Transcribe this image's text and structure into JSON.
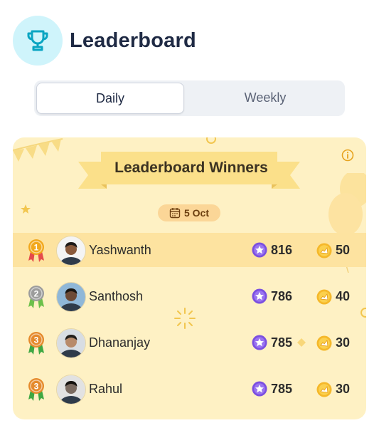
{
  "header": {
    "title": "Leaderboard",
    "icon": "trophy-icon"
  },
  "tabs": [
    {
      "label": "Daily",
      "active": true
    },
    {
      "label": "Weekly",
      "active": false
    }
  ],
  "winners": {
    "title": "Leaderboard Winners",
    "date": "5 Oct",
    "rows": [
      {
        "rank": "1",
        "name": "Yashwanth",
        "gems": "816",
        "coins": "50",
        "medal_color": "#f2a81d",
        "ribbon": "#e54b4b"
      },
      {
        "rank": "2",
        "name": "Santhosh",
        "gems": "786",
        "coins": "40",
        "medal_color": "#9c9c9c",
        "ribbon": "#6cc04a"
      },
      {
        "rank": "3",
        "name": "Dhananjay",
        "gems": "785",
        "coins": "30",
        "medal_color": "#e58a2c",
        "ribbon": "#3fa843"
      },
      {
        "rank": "3",
        "name": "Rahul",
        "gems": "785",
        "coins": "30",
        "medal_color": "#e58a2c",
        "ribbon": "#3fa843"
      }
    ]
  },
  "colors": {
    "card_bg": "#fef1c4",
    "highlight_row": "#fde3a0",
    "gem": "#7b4fe0",
    "coin": "#f5b82a",
    "trophy": "#0aa5c2"
  }
}
